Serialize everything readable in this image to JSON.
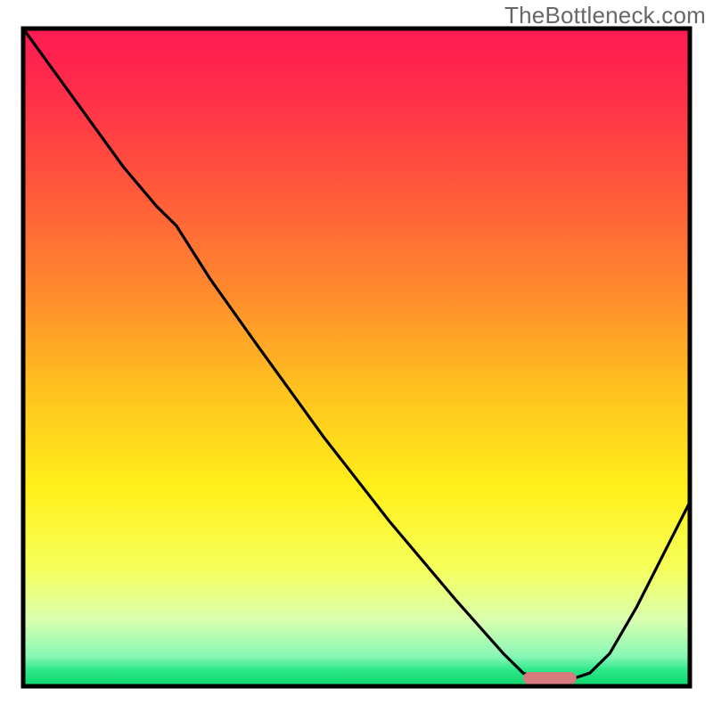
{
  "watermark": "TheBottleneck.com",
  "chart_data": {
    "type": "line",
    "title": "",
    "xlabel": "",
    "ylabel": "",
    "xlim": [
      0,
      100
    ],
    "ylim": [
      0,
      100
    ],
    "note": "Axis is unlabeled; x/y are normalized 0-100 across the plot area. Lower y = bottom of chart = optimal (green).",
    "series": [
      {
        "name": "bottleneck-curve",
        "x": [
          0,
          5,
          10,
          15,
          20,
          23,
          28,
          35,
          45,
          55,
          65,
          72,
          75,
          78,
          82,
          85,
          88,
          92,
          96,
          100
        ],
        "y": [
          100,
          93,
          86,
          79,
          73,
          70,
          62,
          52,
          38,
          25,
          13,
          5,
          2,
          1,
          1,
          2,
          5,
          12,
          20,
          28
        ]
      }
    ],
    "marker": {
      "name": "optimal-range",
      "x_start": 75,
      "x_end": 83,
      "y": 1.2,
      "color": "#d87b7f"
    },
    "gradient_stops": [
      {
        "offset": 0.0,
        "color": "#ff1a52"
      },
      {
        "offset": 0.1,
        "color": "#ff2e4a"
      },
      {
        "offset": 0.25,
        "color": "#ff5a3a"
      },
      {
        "offset": 0.4,
        "color": "#ff8a2e"
      },
      {
        "offset": 0.55,
        "color": "#ffc21f"
      },
      {
        "offset": 0.7,
        "color": "#fff01a"
      },
      {
        "offset": 0.82,
        "color": "#f6ff5a"
      },
      {
        "offset": 0.9,
        "color": "#d9ffb0"
      },
      {
        "offset": 0.955,
        "color": "#86f7b5"
      },
      {
        "offset": 0.975,
        "color": "#2ee88a"
      },
      {
        "offset": 1.0,
        "color": "#0bd66a"
      }
    ],
    "frame_color": "#000000",
    "curve_color": "#000000"
  }
}
